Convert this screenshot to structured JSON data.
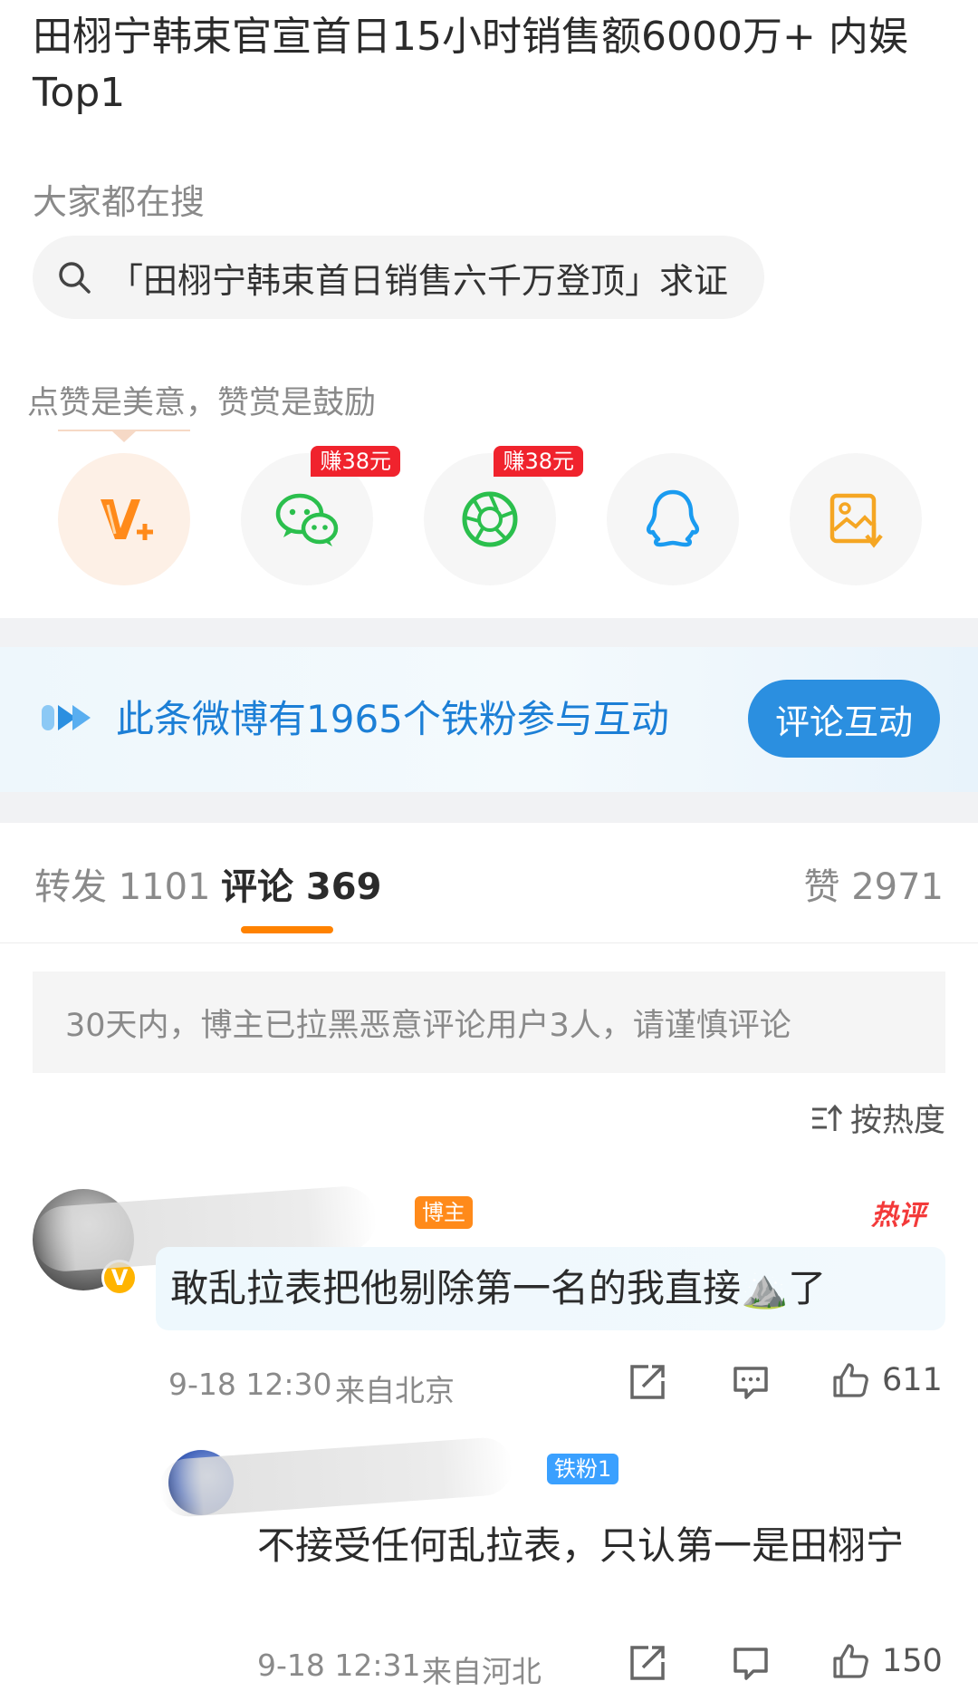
{
  "post": {
    "title": "田栩宁韩束官宣首日15小时销售额6000万+ 内娱Top1"
  },
  "search": {
    "label": "大家都在搜",
    "query": "「田栩宁韩束首日销售六千万登顶」求证"
  },
  "share": {
    "hint": "点赞是美意，赞赏是鼓励",
    "buttons": [
      {
        "icon": "vip-reward-icon",
        "badge": ""
      },
      {
        "icon": "wechat-icon",
        "badge": "赚38元"
      },
      {
        "icon": "moments-icon",
        "badge": "赚38元"
      },
      {
        "icon": "qq-icon",
        "badge": ""
      },
      {
        "icon": "save-image-icon",
        "badge": ""
      }
    ]
  },
  "fan_banner": {
    "text": "此条微博有1965个铁粉参与互动",
    "button": "评论互动"
  },
  "tabs": {
    "repost": "转发 1101",
    "comments": "评论 369",
    "likes": "赞 2971"
  },
  "notice": "30天内，博主已拉黑恶意评论用户3人，请谨慎评论",
  "sort": "按热度",
  "comments": [
    {
      "badge": "博主",
      "tag": "热评",
      "text": "敢乱拉表把他剔除第一名的我直接⛰️了",
      "time": "9-18 12:30",
      "location": "来自北京",
      "likes": "611"
    },
    {
      "badge": "铁粉1",
      "text": "不接受任何乱拉表，只认第一是田栩宁",
      "time": "9-18 12:31",
      "location": "来自河北",
      "likes": "150"
    }
  ],
  "colors": {
    "accent_orange": "#ff8200",
    "link_blue": "#1c7fd6",
    "button_blue": "#2b8fe0",
    "earn_red": "#f0232d",
    "wechat_green": "#2bbf4d",
    "qq_blue": "#1a9bf0",
    "save_orange": "#f5a623"
  }
}
